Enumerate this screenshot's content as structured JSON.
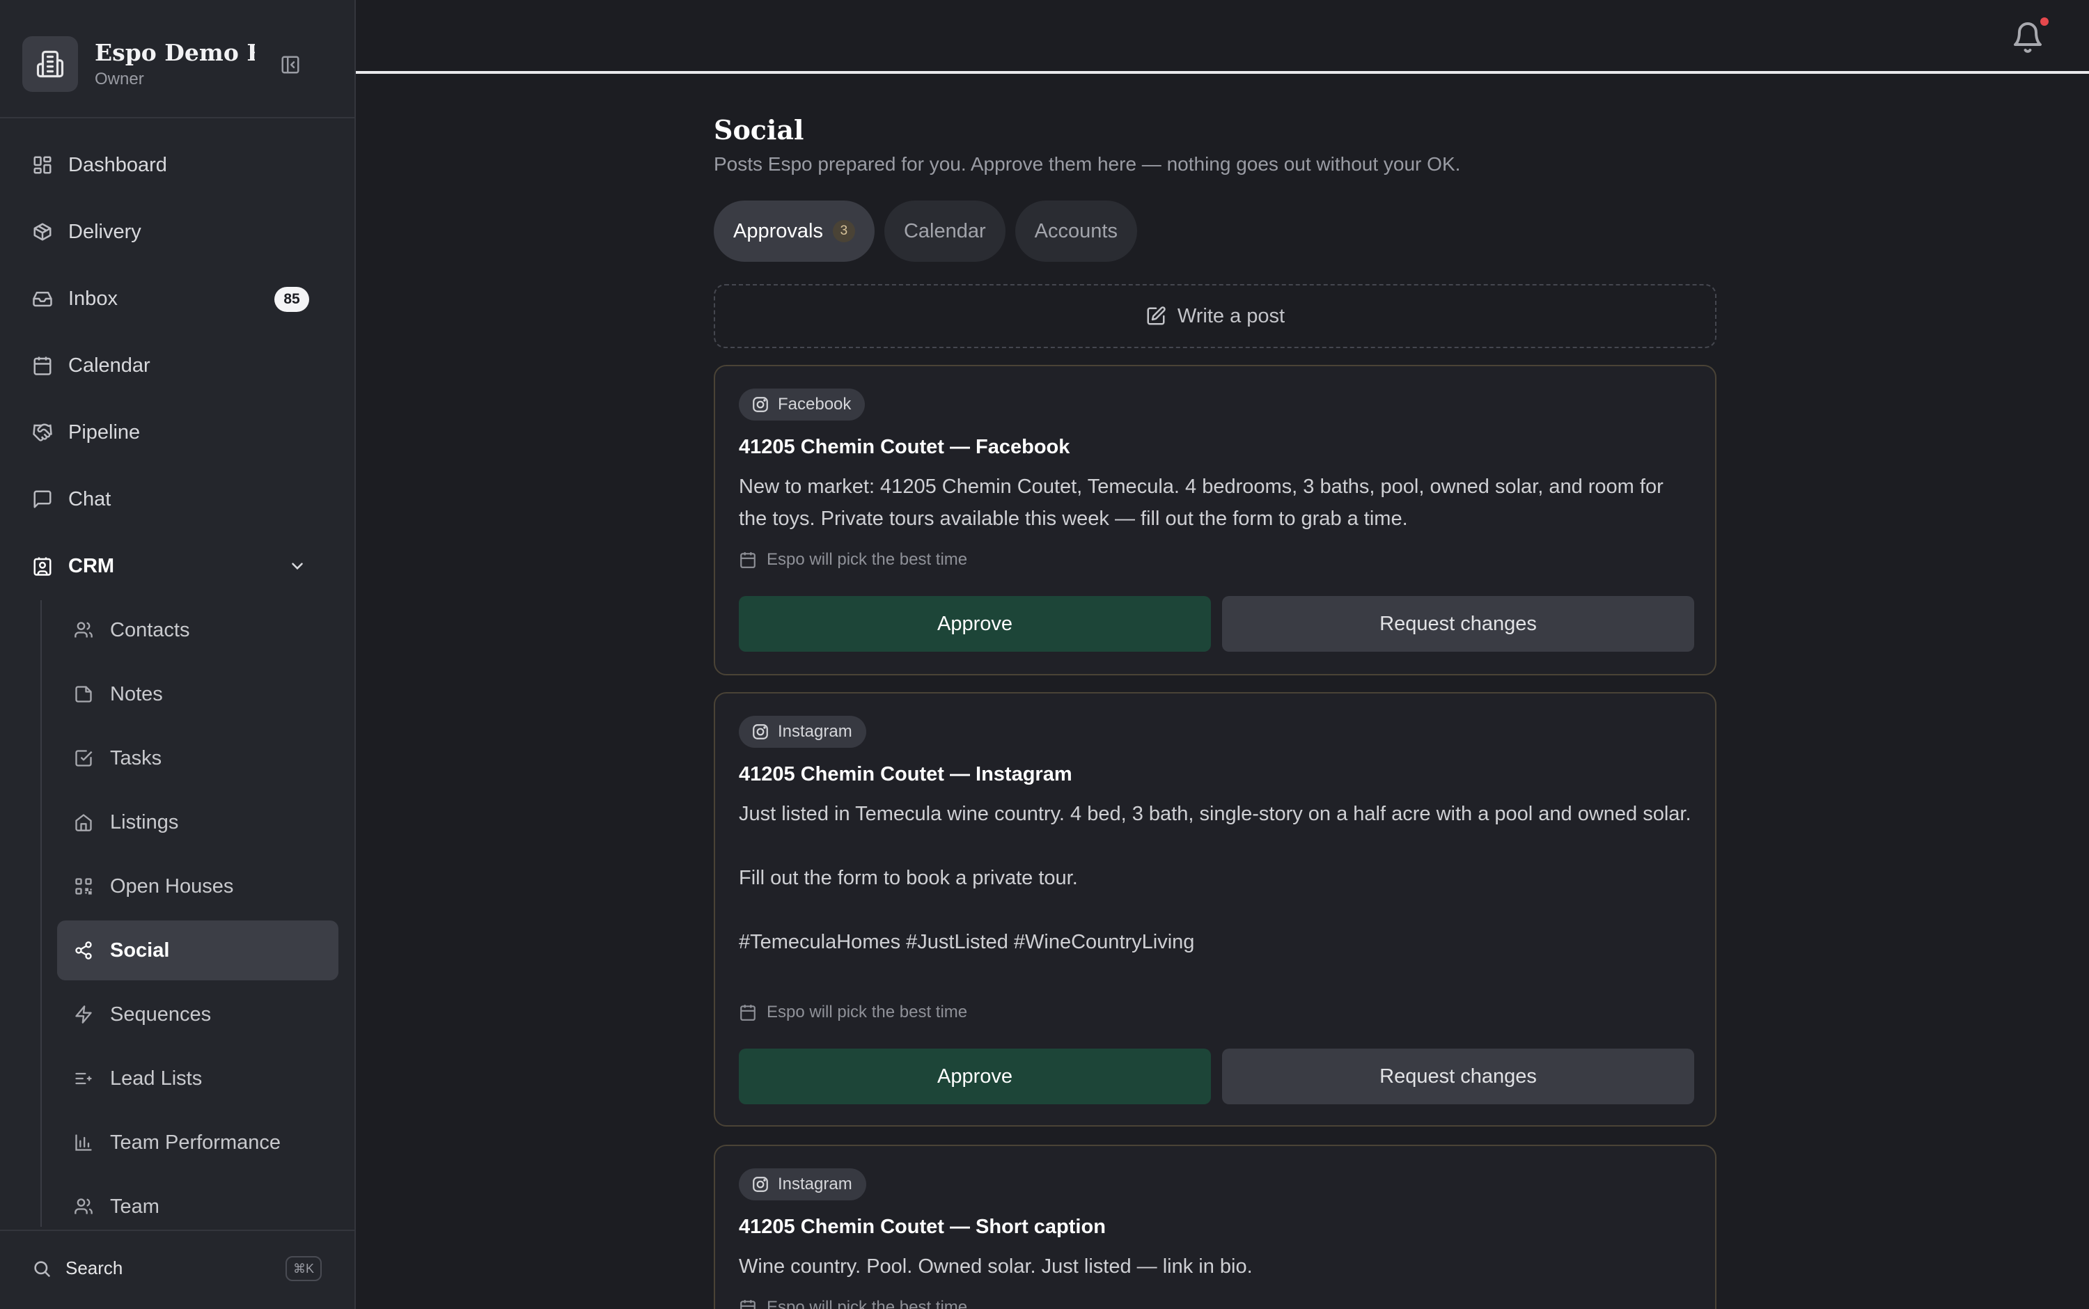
{
  "workspace": {
    "name": "Espo Demo R...",
    "role": "Owner"
  },
  "nav": {
    "dashboard": "Dashboard",
    "delivery": "Delivery",
    "inbox": "Inbox",
    "inbox_badge": "85",
    "calendar": "Calendar",
    "pipeline": "Pipeline",
    "chat": "Chat",
    "crm": "CRM",
    "crm_items": [
      "Contacts",
      "Notes",
      "Tasks",
      "Listings",
      "Open Houses",
      "Social",
      "Sequences",
      "Lead Lists",
      "Team Performance",
      "Team"
    ],
    "active_item": "Social"
  },
  "sidebar_footer": {
    "search_label": "Search",
    "shortcut": "⌘K"
  },
  "page": {
    "title": "Social",
    "subtitle": "Posts Espo prepared for you. Approve them here — nothing goes out without your OK."
  },
  "tabs": [
    {
      "label": "Approvals",
      "count": "3",
      "active": true
    },
    {
      "label": "Calendar",
      "active": false
    },
    {
      "label": "Accounts",
      "active": false
    }
  ],
  "write_post_label": "Write a post",
  "posts": [
    {
      "platform": "Facebook",
      "title": "41205 Chemin Coutet — Facebook",
      "body": "New to market: 41205 Chemin Coutet, Temecula. 4 bedrooms, 3 baths, pool, owned solar, and room for the toys. Private tours available this week — fill out the form to grab a time.",
      "schedule": "Espo will pick the best time",
      "approve_label": "Approve",
      "changes_label": "Request changes"
    },
    {
      "platform": "Instagram",
      "title": "41205 Chemin Coutet — Instagram",
      "body": "Just listed in Temecula wine country. 4 bed, 3 bath, single-story on a half acre with a pool and owned solar.\n\nFill out the form to book a private tour.\n\n#TemeculaHomes #JustListed #WineCountryLiving",
      "schedule": "Espo will pick the best time",
      "approve_label": "Approve",
      "changes_label": "Request changes"
    },
    {
      "platform": "Instagram",
      "title": "41205 Chemin Coutet — Short caption",
      "body": "Wine country. Pool. Owned solar. Just listed — link in bio.",
      "schedule": "Espo will pick the best time"
    }
  ],
  "colors": {
    "approve": "#1d4538",
    "card_border": "#4a4336",
    "notification_dot": "#e5484d"
  }
}
